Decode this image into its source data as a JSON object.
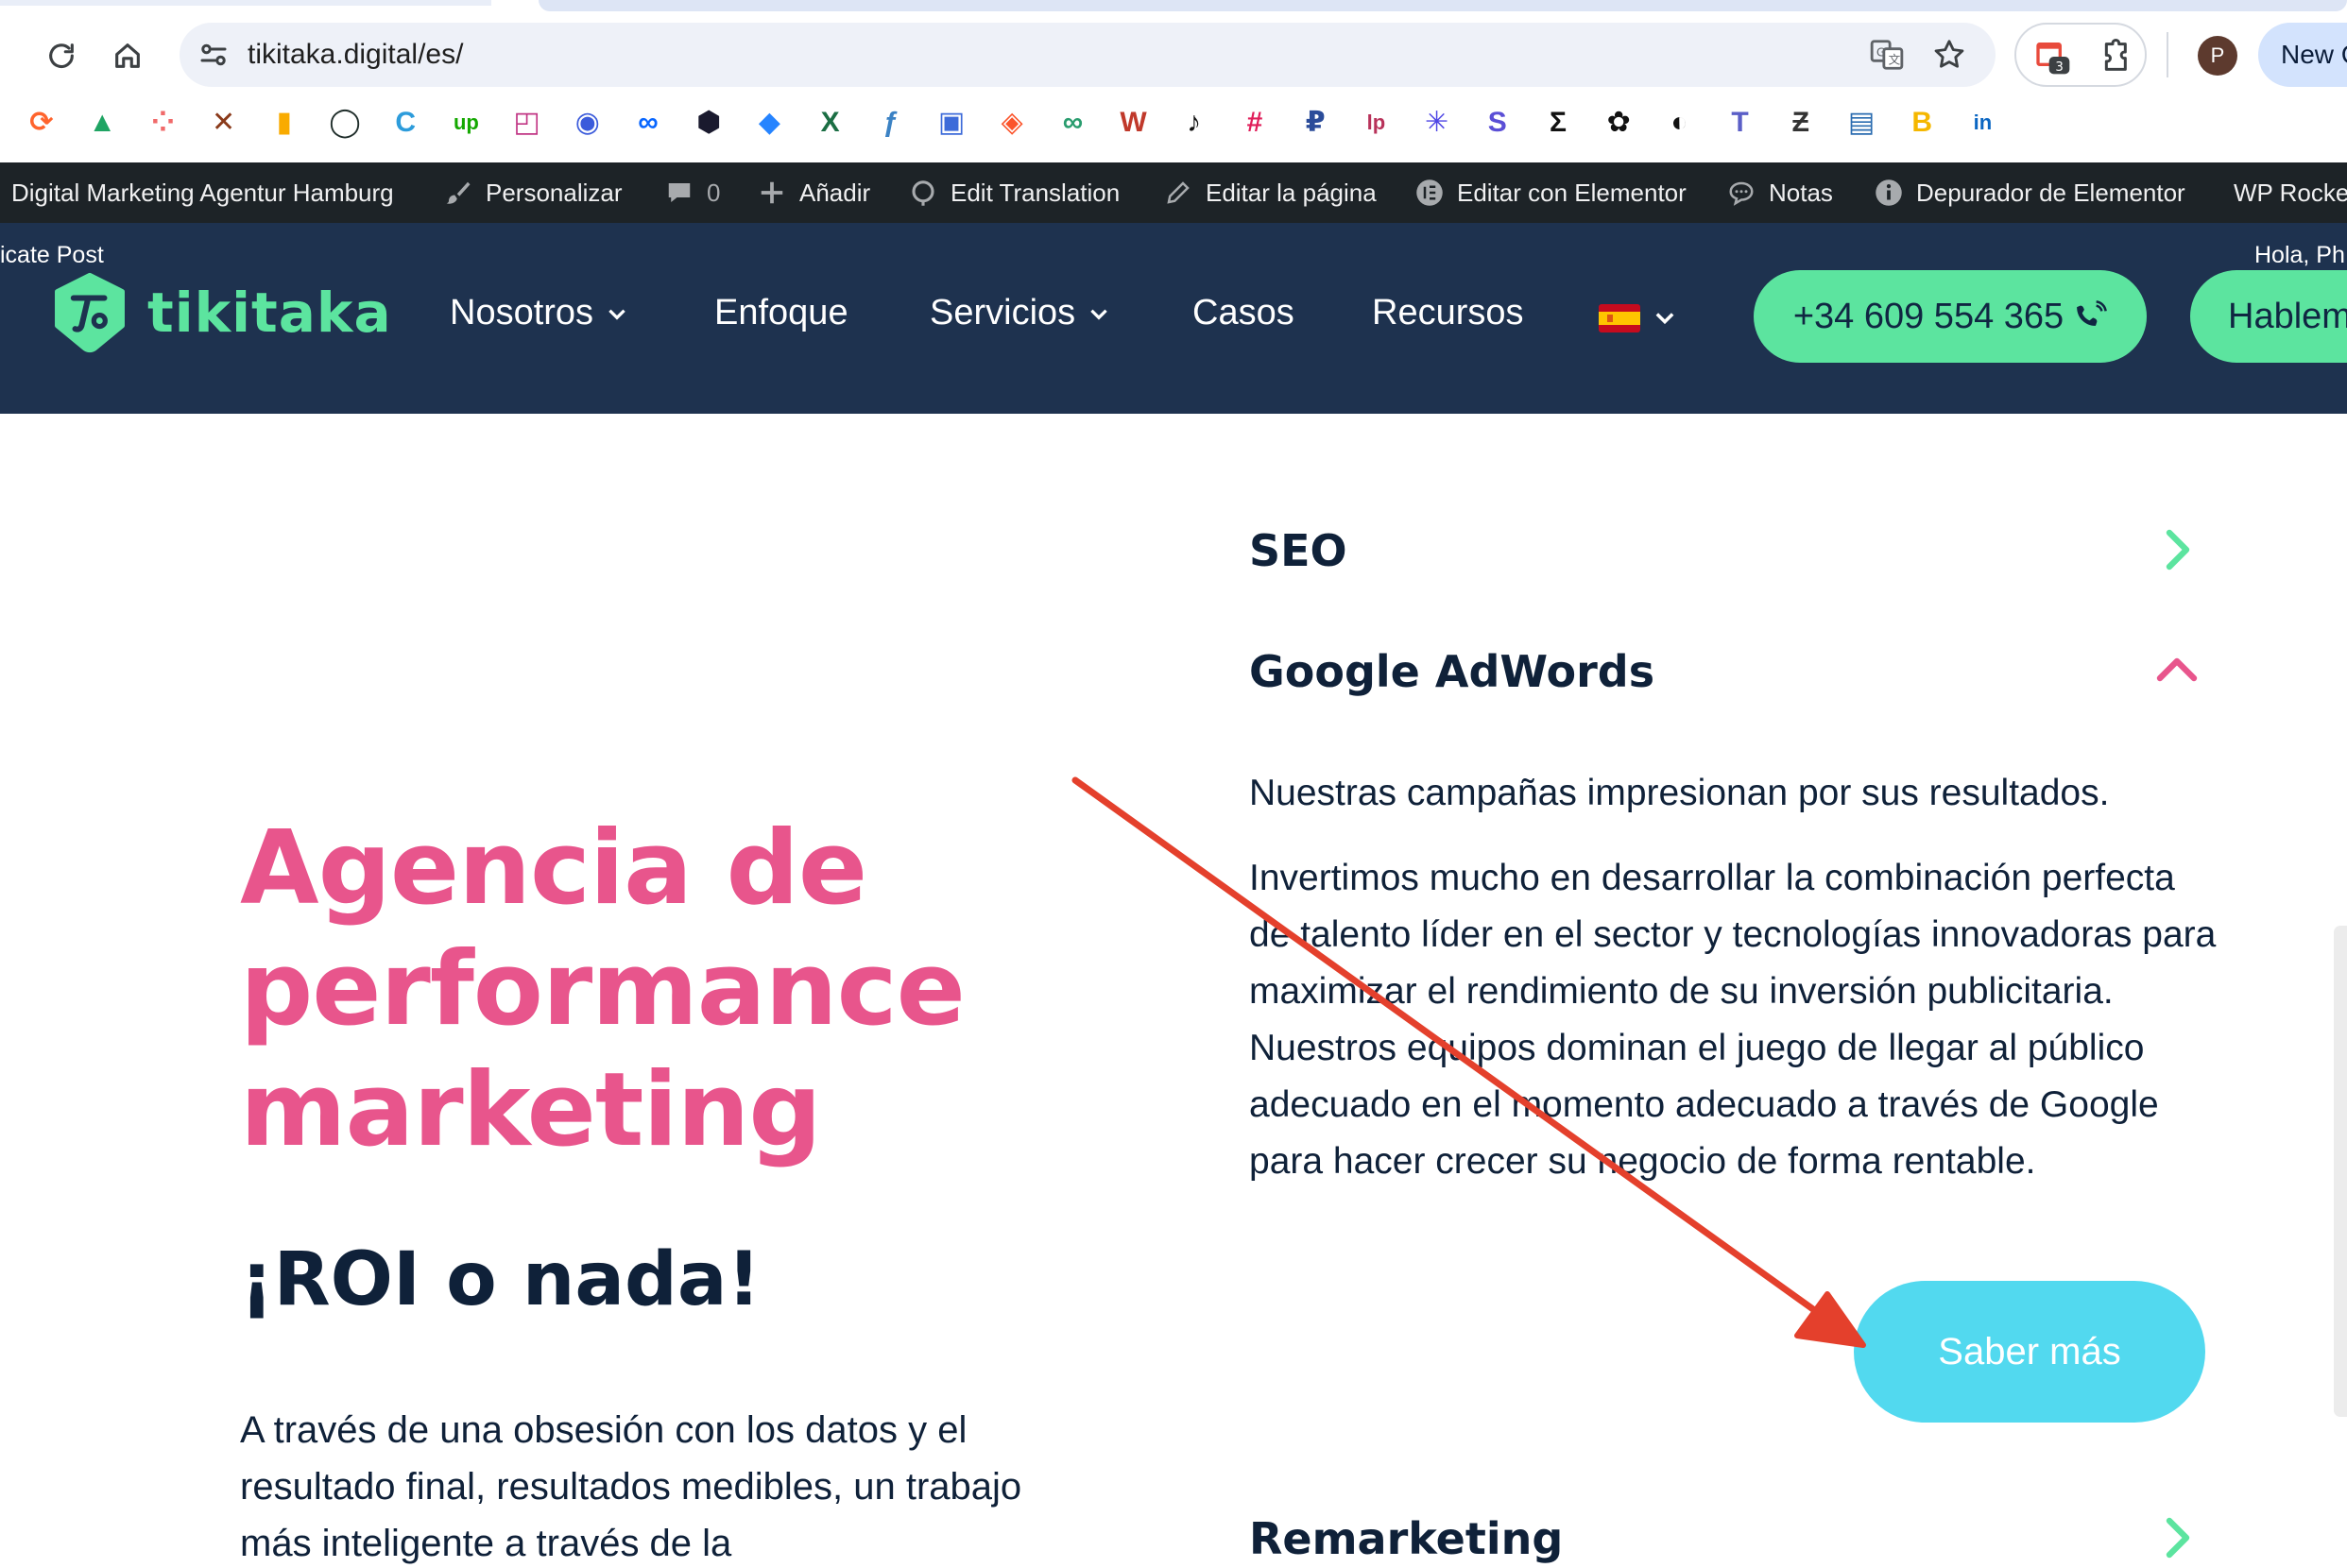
{
  "browser": {
    "url": "tikitaka.digital/es/",
    "avatar_letter": "P",
    "extension_badge": "3",
    "new_chrome_label": "New C"
  },
  "bookmarks": [
    {
      "name": "semrush-icon",
      "glyph": "⟳",
      "color": "#ff642d"
    },
    {
      "name": "google-drive-icon",
      "glyph": "▲",
      "color": "#1fa463"
    },
    {
      "name": "asana-icon",
      "glyph": "⁘",
      "color": "#f06a6a"
    },
    {
      "name": "x-logo-icon",
      "glyph": "✕",
      "color": "#8a3a1a"
    },
    {
      "name": "analytics-icon",
      "glyph": "▮",
      "color": "#f9ab00"
    },
    {
      "name": "circle-icon",
      "glyph": "◯",
      "color": "#1f2d2a"
    },
    {
      "name": "c-app-icon",
      "glyph": "C",
      "color": "#2d9cdb"
    },
    {
      "name": "upwork-icon",
      "glyph": "up",
      "color": "#14a800"
    },
    {
      "name": "instagram-icon",
      "glyph": "◰",
      "color": "#c13584"
    },
    {
      "name": "target-icon",
      "glyph": "◉",
      "color": "#3b5bdb"
    },
    {
      "name": "meta-icon",
      "glyph": "∞",
      "color": "#0866ff"
    },
    {
      "name": "hexagon-icon",
      "glyph": "⬢",
      "color": "#1a1a2e"
    },
    {
      "name": "jira-icon",
      "glyph": "◆",
      "color": "#2684ff"
    },
    {
      "name": "excel-icon",
      "glyph": "X",
      "color": "#1b6e44"
    },
    {
      "name": "f-app-icon",
      "glyph": "ƒ",
      "color": "#3b82c4"
    },
    {
      "name": "clipboard-icon",
      "glyph": "▣",
      "color": "#3d6bd9"
    },
    {
      "name": "brave-icon",
      "glyph": "◈",
      "color": "#fb542b"
    },
    {
      "name": "link-icon",
      "glyph": "∞",
      "color": "#2a9d6f"
    },
    {
      "name": "w-app-icon",
      "glyph": "W",
      "color": "#c0392b"
    },
    {
      "name": "tiktok-icon",
      "glyph": "♪",
      "color": "#111111"
    },
    {
      "name": "slack-icon",
      "glyph": "#",
      "color": "#e01e5a"
    },
    {
      "name": "paywise-icon",
      "glyph": "₽",
      "color": "#2b4c9a"
    },
    {
      "name": "lp-icon",
      "glyph": "lp",
      "color": "#b8325a"
    },
    {
      "name": "asterisk-icon",
      "glyph": "✳",
      "color": "#4f46e5"
    },
    {
      "name": "s-app-icon",
      "glyph": "S",
      "color": "#5b4fd6"
    },
    {
      "name": "sigma-icon",
      "glyph": "Σ",
      "color": "#111111"
    },
    {
      "name": "openai-icon",
      "glyph": "✿",
      "color": "#111111"
    },
    {
      "name": "disc-icon",
      "glyph": "◐",
      "color": "#111111"
    },
    {
      "name": "teams-icon",
      "glyph": "T",
      "color": "#5b5fc7"
    },
    {
      "name": "z-app-icon",
      "glyph": "Ƶ",
      "color": "#333333"
    },
    {
      "name": "docs-icon",
      "glyph": "▤",
      "color": "#2b6cb0"
    },
    {
      "name": "b-app-icon",
      "glyph": "B",
      "color": "#f5b700"
    },
    {
      "name": "linkedin-icon",
      "glyph": "in",
      "color": "#0a66c2"
    }
  ],
  "wpbar": {
    "site_name": "Digital Marketing Agentur Hamburg",
    "customize": "Personalizar",
    "comments_count": "0",
    "add_new": "Añadir",
    "edit_translation": "Edit Translation",
    "edit_page": "Editar la página",
    "edit_elementor": "Editar con Elementor",
    "notes": "Notas",
    "debugger": "Depurador de Elementor",
    "wp_rocket": "WP Rocket"
  },
  "header": {
    "duplicate_post": "icate Post",
    "greeting": "Hola, Ph",
    "logo_text": "tikitaka",
    "menu": {
      "nosotros": "Nosotros",
      "enfoque": "Enfoque",
      "servicios": "Servicios",
      "casos": "Casos",
      "recursos": "Recursos"
    },
    "phone": "+34 609 554 365",
    "talk_button": "Hablem"
  },
  "hero": {
    "title_line1": "Agencia de",
    "title_line2": "performance",
    "title_line3": "marketing",
    "subtitle": "¡ROI o nada!",
    "paragraph": "A través de una obsesión con los datos y el resultado final, resultados medibles, un trabajo más inteligente a través de la"
  },
  "accordion": {
    "seo_title": "SEO",
    "adwords_title": "Google AdWords",
    "adwords_lead": "Nuestras campañas impresionan por sus resultados.",
    "adwords_body": "Invertimos mucho en desarrollar la combinación perfecta de talento líder en el sector y tecnologías innovadoras para maximizar el rendimiento de su inversión publicitaria. Nuestros equipos dominan el juego de llegar al público adecuado en el momento adecuado a través de Google para hacer crecer su negocio de forma rentable.",
    "cta_label": "Saber más",
    "remarketing_title": "Remarketing"
  },
  "colors": {
    "brand_green": "#5ce49f",
    "brand_pink": "#e8558c",
    "header_navy": "#1e324f",
    "cta_cyan": "#52d9ef",
    "annotation_red": "#e4402c"
  }
}
